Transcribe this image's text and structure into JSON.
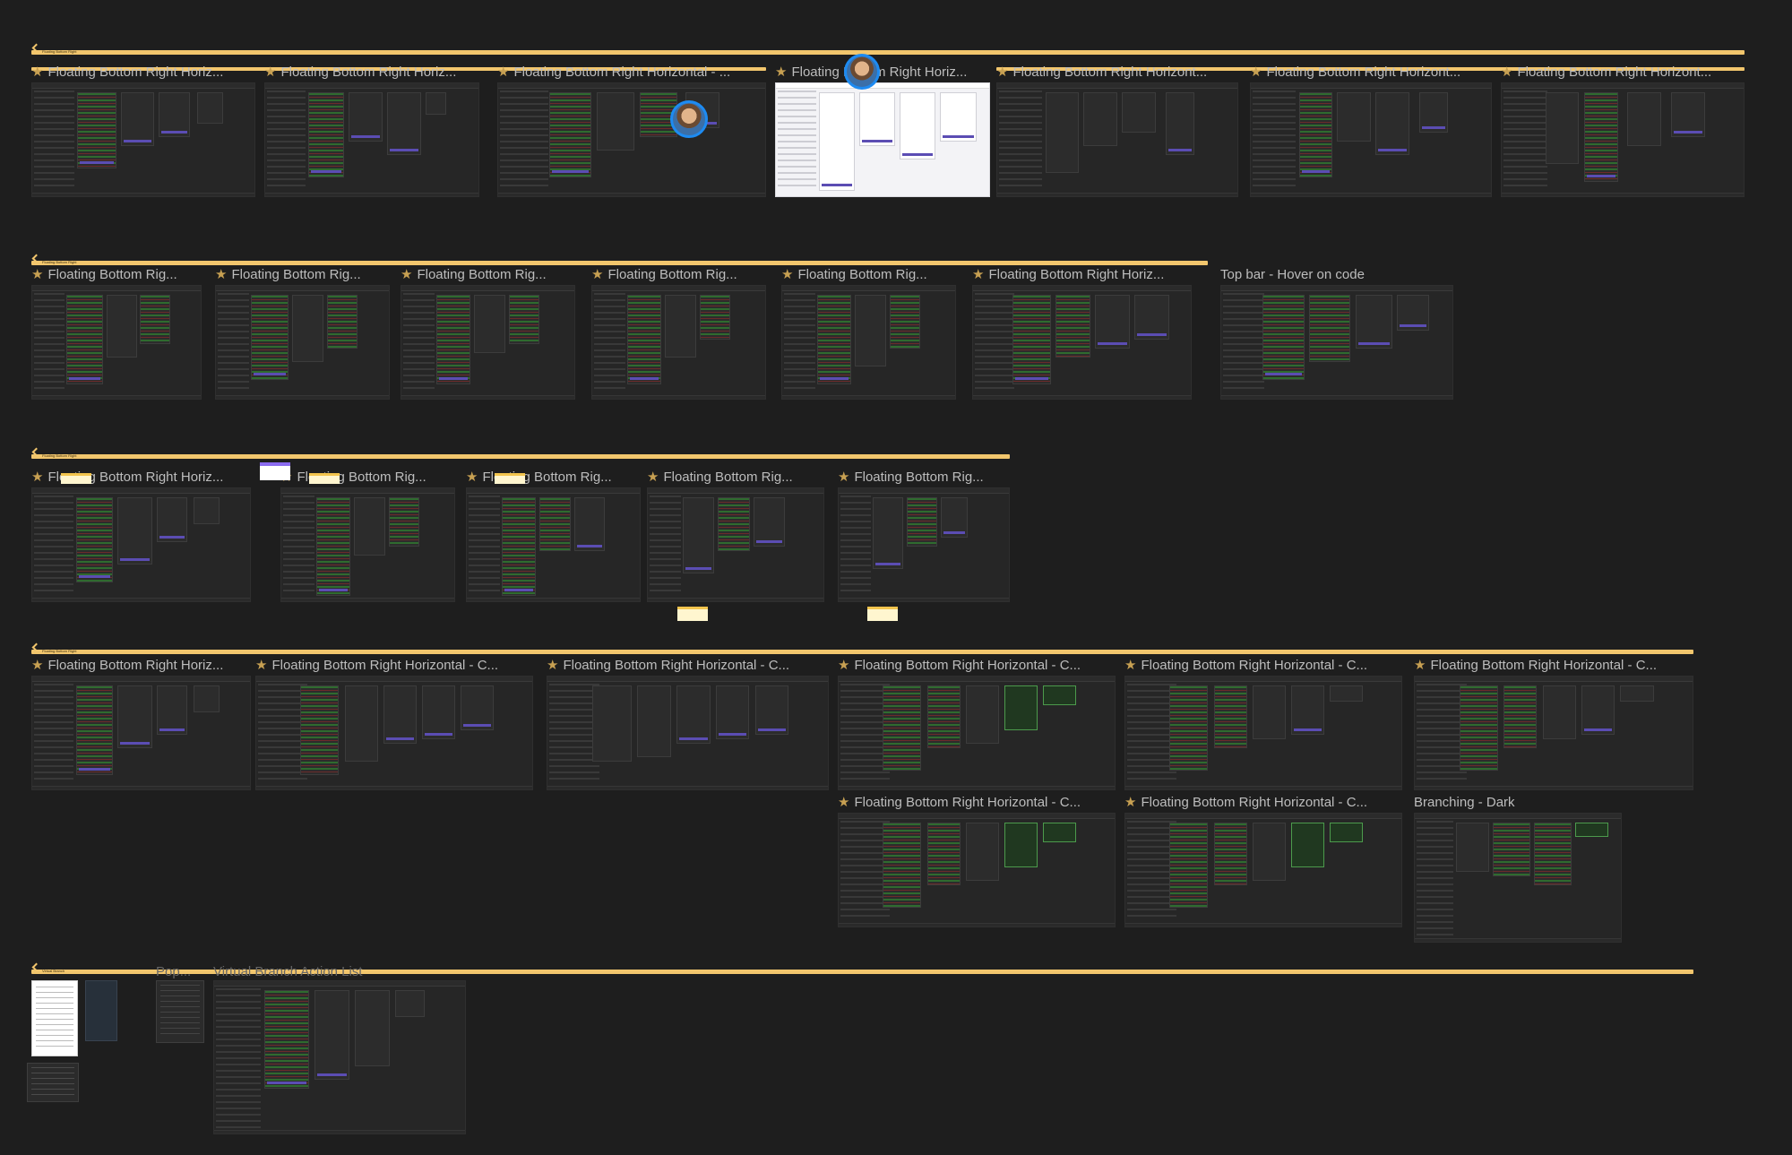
{
  "canvas": {
    "background": "#1e1e1e",
    "section_color": "#f2c66d",
    "star_color": "#c7a052",
    "accent_purple": "#5b4db3"
  },
  "sections": [
    {
      "id": "s1",
      "label": "Floating Bottom Right"
    },
    {
      "id": "s2",
      "label": "Floating Bottom Right"
    },
    {
      "id": "s3",
      "label": "Floating Bottom Right"
    },
    {
      "id": "s4",
      "label": "Floating Bottom Right"
    },
    {
      "id": "s5",
      "label": "Virtual Branch"
    }
  ],
  "frames": {
    "r1": [
      "Floating Bottom Right Horiz...",
      "Floating Bottom Right Horiz...",
      "Floating Bottom Right Horizontal - ...",
      "Floating Bottom Right Horiz...",
      "Floating Bottom Right Horizont...",
      "Floating Bottom Right Horizont...",
      "Floating Bottom Right Horizont..."
    ],
    "r2": [
      "Floating Bottom Rig...",
      "Floating Bottom Rig...",
      "Floating Bottom Rig...",
      "Floating Bottom Rig...",
      "Floating Bottom Rig...",
      "Floating Bottom Right Horiz...",
      "Top bar - Hover  on code"
    ],
    "r3": [
      "Floating Bottom Right Horiz...",
      "Floating Bottom Rig...",
      "Floating Bottom Rig...",
      "Floating Bottom Rig...",
      "Floating Bottom Rig..."
    ],
    "r4": [
      "Floating Bottom Right Horiz...",
      "Floating Bottom Right Horizontal - C...",
      "Floating Bottom Right Horizontal - C...",
      "Floating Bottom Right Horizontal - C...",
      "Floating Bottom Right Horizontal - C...",
      "Floating Bottom Right Horizontal - C..."
    ],
    "r5": [
      "Floating Bottom Right Horizontal - C...",
      "Floating Bottom Right Horizontal - C...",
      "Branching - Dark"
    ],
    "r6": [
      "Pop...",
      "Virtual Branch Action List"
    ]
  },
  "icons": {
    "frame_marker": "star-icon",
    "collaborator": "avatar-icon",
    "section_marker": "arrow-icon"
  }
}
